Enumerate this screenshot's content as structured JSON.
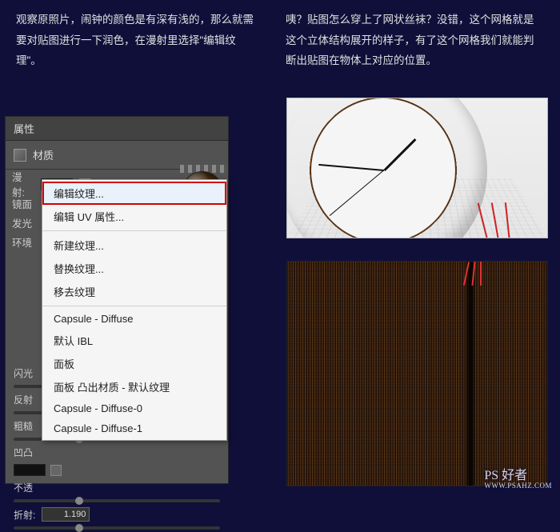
{
  "descriptions": {
    "left": "观察原照片，闹钟的颜色是有深有浅的，那么就需要对贴图进行一下润色，在漫射里选择\"编辑纹理\"。",
    "right": "咦？贴图怎么穿上了网状丝袜？没错，这个网格就是这个立体结构展开的样子，有了这个网格我们就能判断出贴图在物体上对应的位置。"
  },
  "panel": {
    "title": "属性",
    "tab": "材质",
    "rows": {
      "diffuse": "漫射:",
      "specular": "镜面",
      "glow": "发光",
      "env": "环境",
      "flash": "闪光",
      "reflect": "反射",
      "rough": "粗糙",
      "bump": "凹凸",
      "opacity": "不透",
      "refract": "折射:",
      "refract_value": "1.190"
    }
  },
  "menu": {
    "edit_texture": "编辑纹理...",
    "edit_uv": "编辑 UV 属性...",
    "new_texture": "新建纹理...",
    "replace_texture": "替换纹理...",
    "remove_texture": "移去纹理",
    "capsule_diffuse": "Capsule - Diffuse",
    "default_ibl": "默认 IBL",
    "panel": "面板",
    "panel_bump": "面板 凸出材质 - 默认纹理",
    "capsule_d0": "Capsule - Diffuse-0",
    "capsule_d1": "Capsule - Diffuse-1"
  },
  "watermark": {
    "main": "PS 好者",
    "sub": "WWW.PSAHZ.COM"
  }
}
